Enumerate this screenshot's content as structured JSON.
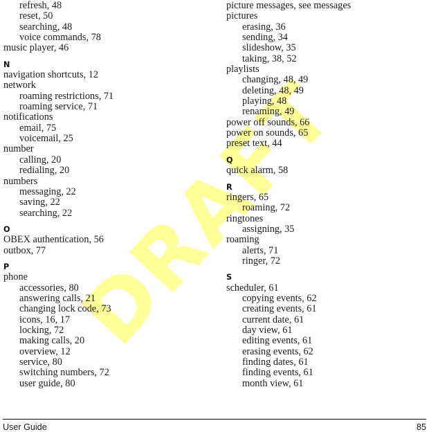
{
  "document": {
    "type": "index",
    "watermark": "DRAFT",
    "watermark_color": "#ffff99",
    "text_color": "#1c1c1c"
  },
  "footer": {
    "left_label": "User Guide",
    "page_number": "85"
  },
  "columns": [
    {
      "name": "left-column",
      "entries": [
        {
          "kind": "entry",
          "level": 2,
          "text": "refresh, 48"
        },
        {
          "kind": "entry",
          "level": 2,
          "text": "reset, 50"
        },
        {
          "kind": "entry",
          "level": 2,
          "text": "searching, 48"
        },
        {
          "kind": "entry",
          "level": 2,
          "text": "voice commands, 78"
        },
        {
          "kind": "entry",
          "level": 1,
          "text": "music player, 46"
        },
        {
          "kind": "heading",
          "text": "N"
        },
        {
          "kind": "entry",
          "level": 1,
          "text": "navigation shortcuts, 12"
        },
        {
          "kind": "entry",
          "level": 1,
          "text": "network"
        },
        {
          "kind": "entry",
          "level": 2,
          "text": "roaming restrictions, 71"
        },
        {
          "kind": "entry",
          "level": 2,
          "text": "roaming service, 71"
        },
        {
          "kind": "entry",
          "level": 1,
          "text": "notifications"
        },
        {
          "kind": "entry",
          "level": 2,
          "text": "email, 75"
        },
        {
          "kind": "entry",
          "level": 2,
          "text": "voicemail, 25"
        },
        {
          "kind": "entry",
          "level": 1,
          "text": "number"
        },
        {
          "kind": "entry",
          "level": 2,
          "text": "calling, 20"
        },
        {
          "kind": "entry",
          "level": 2,
          "text": "redialing, 20"
        },
        {
          "kind": "entry",
          "level": 1,
          "text": "numbers"
        },
        {
          "kind": "entry",
          "level": 2,
          "text": "messaging, 22"
        },
        {
          "kind": "entry",
          "level": 2,
          "text": "saving, 22"
        },
        {
          "kind": "entry",
          "level": 2,
          "text": "searching, 22"
        },
        {
          "kind": "heading",
          "text": "O"
        },
        {
          "kind": "entry",
          "level": 1,
          "text": "OBEX authentication, 56"
        },
        {
          "kind": "entry",
          "level": 1,
          "text": "outbox, 77"
        },
        {
          "kind": "heading",
          "text": "P"
        },
        {
          "kind": "entry",
          "level": 1,
          "text": "phone"
        },
        {
          "kind": "entry",
          "level": 2,
          "text": "accessories, 80"
        },
        {
          "kind": "entry",
          "level": 2,
          "text": "answering calls, 21"
        },
        {
          "kind": "entry",
          "level": 2,
          "text": "changing lock code, 73"
        },
        {
          "kind": "entry",
          "level": 2,
          "text": "icons, 16, 17"
        },
        {
          "kind": "entry",
          "level": 2,
          "text": "locking, 72"
        },
        {
          "kind": "entry",
          "level": 2,
          "text": "making calls, 20"
        },
        {
          "kind": "entry",
          "level": 2,
          "text": "overview, 12"
        },
        {
          "kind": "entry",
          "level": 2,
          "text": "service, 80"
        },
        {
          "kind": "entry",
          "level": 2,
          "text": "switching numbers, 72"
        },
        {
          "kind": "entry",
          "level": 2,
          "text": "user guide, 80"
        }
      ]
    },
    {
      "name": "right-column",
      "entries": [
        {
          "kind": "entry",
          "level": 1,
          "text": "picture messages, see messages"
        },
        {
          "kind": "entry",
          "level": 1,
          "text": "pictures"
        },
        {
          "kind": "entry",
          "level": 2,
          "text": "erasing, 36"
        },
        {
          "kind": "entry",
          "level": 2,
          "text": "sending, 34"
        },
        {
          "kind": "entry",
          "level": 2,
          "text": "slideshow, 35"
        },
        {
          "kind": "entry",
          "level": 2,
          "text": "taking, 38, 52"
        },
        {
          "kind": "entry",
          "level": 1,
          "text": "playlists"
        },
        {
          "kind": "entry",
          "level": 2,
          "text": "changing, 48, 49"
        },
        {
          "kind": "entry",
          "level": 2,
          "text": "deleting, 48, 49"
        },
        {
          "kind": "entry",
          "level": 2,
          "text": "playing, 48"
        },
        {
          "kind": "entry",
          "level": 2,
          "text": "renaming, 49"
        },
        {
          "kind": "entry",
          "level": 1,
          "text": "power off sounds, 66"
        },
        {
          "kind": "entry",
          "level": 1,
          "text": "power on sounds, 65"
        },
        {
          "kind": "entry",
          "level": 1,
          "text": "preset text, 44"
        },
        {
          "kind": "heading",
          "text": "Q"
        },
        {
          "kind": "entry",
          "level": 1,
          "text": "quick alarm, 58"
        },
        {
          "kind": "heading",
          "text": "R"
        },
        {
          "kind": "entry",
          "level": 1,
          "text": "ringers, 65"
        },
        {
          "kind": "entry",
          "level": 2,
          "text": "roaming, 72"
        },
        {
          "kind": "entry",
          "level": 1,
          "text": "ringtones"
        },
        {
          "kind": "entry",
          "level": 2,
          "text": "assigning, 35"
        },
        {
          "kind": "entry",
          "level": 1,
          "text": "roaming"
        },
        {
          "kind": "entry",
          "level": 2,
          "text": "alerts, 71"
        },
        {
          "kind": "entry",
          "level": 2,
          "text": "ringer, 72"
        },
        {
          "kind": "heading",
          "text": "S"
        },
        {
          "kind": "entry",
          "level": 1,
          "text": "scheduler, 61"
        },
        {
          "kind": "entry",
          "level": 2,
          "text": "copying events, 62"
        },
        {
          "kind": "entry",
          "level": 2,
          "text": "creating events, 61"
        },
        {
          "kind": "entry",
          "level": 2,
          "text": "current date, 61"
        },
        {
          "kind": "entry",
          "level": 2,
          "text": "day view, 61"
        },
        {
          "kind": "entry",
          "level": 2,
          "text": "editing events, 61"
        },
        {
          "kind": "entry",
          "level": 2,
          "text": "erasing events, 62"
        },
        {
          "kind": "entry",
          "level": 2,
          "text": "finding dates, 61"
        },
        {
          "kind": "entry",
          "level": 2,
          "text": "finding events, 61"
        },
        {
          "kind": "entry",
          "level": 2,
          "text": "month view, 61"
        }
      ]
    }
  ]
}
